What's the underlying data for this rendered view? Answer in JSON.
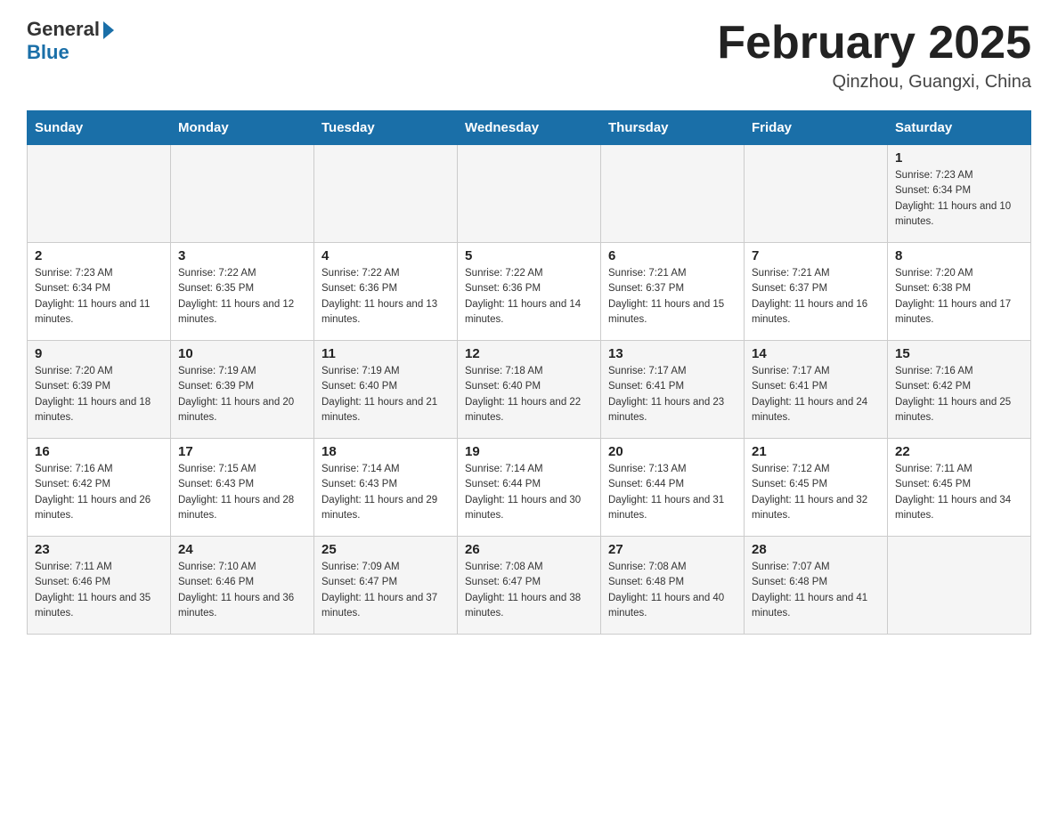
{
  "header": {
    "logo": {
      "general": "General",
      "blue": "Blue"
    },
    "title": "February 2025",
    "location": "Qinzhou, Guangxi, China"
  },
  "days_of_week": [
    "Sunday",
    "Monday",
    "Tuesday",
    "Wednesday",
    "Thursday",
    "Friday",
    "Saturday"
  ],
  "weeks": [
    [
      {
        "day": "",
        "info": ""
      },
      {
        "day": "",
        "info": ""
      },
      {
        "day": "",
        "info": ""
      },
      {
        "day": "",
        "info": ""
      },
      {
        "day": "",
        "info": ""
      },
      {
        "day": "",
        "info": ""
      },
      {
        "day": "1",
        "info": "Sunrise: 7:23 AM\nSunset: 6:34 PM\nDaylight: 11 hours and 10 minutes."
      }
    ],
    [
      {
        "day": "2",
        "info": "Sunrise: 7:23 AM\nSunset: 6:34 PM\nDaylight: 11 hours and 11 minutes."
      },
      {
        "day": "3",
        "info": "Sunrise: 7:22 AM\nSunset: 6:35 PM\nDaylight: 11 hours and 12 minutes."
      },
      {
        "day": "4",
        "info": "Sunrise: 7:22 AM\nSunset: 6:36 PM\nDaylight: 11 hours and 13 minutes."
      },
      {
        "day": "5",
        "info": "Sunrise: 7:22 AM\nSunset: 6:36 PM\nDaylight: 11 hours and 14 minutes."
      },
      {
        "day": "6",
        "info": "Sunrise: 7:21 AM\nSunset: 6:37 PM\nDaylight: 11 hours and 15 minutes."
      },
      {
        "day": "7",
        "info": "Sunrise: 7:21 AM\nSunset: 6:37 PM\nDaylight: 11 hours and 16 minutes."
      },
      {
        "day": "8",
        "info": "Sunrise: 7:20 AM\nSunset: 6:38 PM\nDaylight: 11 hours and 17 minutes."
      }
    ],
    [
      {
        "day": "9",
        "info": "Sunrise: 7:20 AM\nSunset: 6:39 PM\nDaylight: 11 hours and 18 minutes."
      },
      {
        "day": "10",
        "info": "Sunrise: 7:19 AM\nSunset: 6:39 PM\nDaylight: 11 hours and 20 minutes."
      },
      {
        "day": "11",
        "info": "Sunrise: 7:19 AM\nSunset: 6:40 PM\nDaylight: 11 hours and 21 minutes."
      },
      {
        "day": "12",
        "info": "Sunrise: 7:18 AM\nSunset: 6:40 PM\nDaylight: 11 hours and 22 minutes."
      },
      {
        "day": "13",
        "info": "Sunrise: 7:17 AM\nSunset: 6:41 PM\nDaylight: 11 hours and 23 minutes."
      },
      {
        "day": "14",
        "info": "Sunrise: 7:17 AM\nSunset: 6:41 PM\nDaylight: 11 hours and 24 minutes."
      },
      {
        "day": "15",
        "info": "Sunrise: 7:16 AM\nSunset: 6:42 PM\nDaylight: 11 hours and 25 minutes."
      }
    ],
    [
      {
        "day": "16",
        "info": "Sunrise: 7:16 AM\nSunset: 6:42 PM\nDaylight: 11 hours and 26 minutes."
      },
      {
        "day": "17",
        "info": "Sunrise: 7:15 AM\nSunset: 6:43 PM\nDaylight: 11 hours and 28 minutes."
      },
      {
        "day": "18",
        "info": "Sunrise: 7:14 AM\nSunset: 6:43 PM\nDaylight: 11 hours and 29 minutes."
      },
      {
        "day": "19",
        "info": "Sunrise: 7:14 AM\nSunset: 6:44 PM\nDaylight: 11 hours and 30 minutes."
      },
      {
        "day": "20",
        "info": "Sunrise: 7:13 AM\nSunset: 6:44 PM\nDaylight: 11 hours and 31 minutes."
      },
      {
        "day": "21",
        "info": "Sunrise: 7:12 AM\nSunset: 6:45 PM\nDaylight: 11 hours and 32 minutes."
      },
      {
        "day": "22",
        "info": "Sunrise: 7:11 AM\nSunset: 6:45 PM\nDaylight: 11 hours and 34 minutes."
      }
    ],
    [
      {
        "day": "23",
        "info": "Sunrise: 7:11 AM\nSunset: 6:46 PM\nDaylight: 11 hours and 35 minutes."
      },
      {
        "day": "24",
        "info": "Sunrise: 7:10 AM\nSunset: 6:46 PM\nDaylight: 11 hours and 36 minutes."
      },
      {
        "day": "25",
        "info": "Sunrise: 7:09 AM\nSunset: 6:47 PM\nDaylight: 11 hours and 37 minutes."
      },
      {
        "day": "26",
        "info": "Sunrise: 7:08 AM\nSunset: 6:47 PM\nDaylight: 11 hours and 38 minutes."
      },
      {
        "day": "27",
        "info": "Sunrise: 7:08 AM\nSunset: 6:48 PM\nDaylight: 11 hours and 40 minutes."
      },
      {
        "day": "28",
        "info": "Sunrise: 7:07 AM\nSunset: 6:48 PM\nDaylight: 11 hours and 41 minutes."
      },
      {
        "day": "",
        "info": ""
      }
    ]
  ]
}
